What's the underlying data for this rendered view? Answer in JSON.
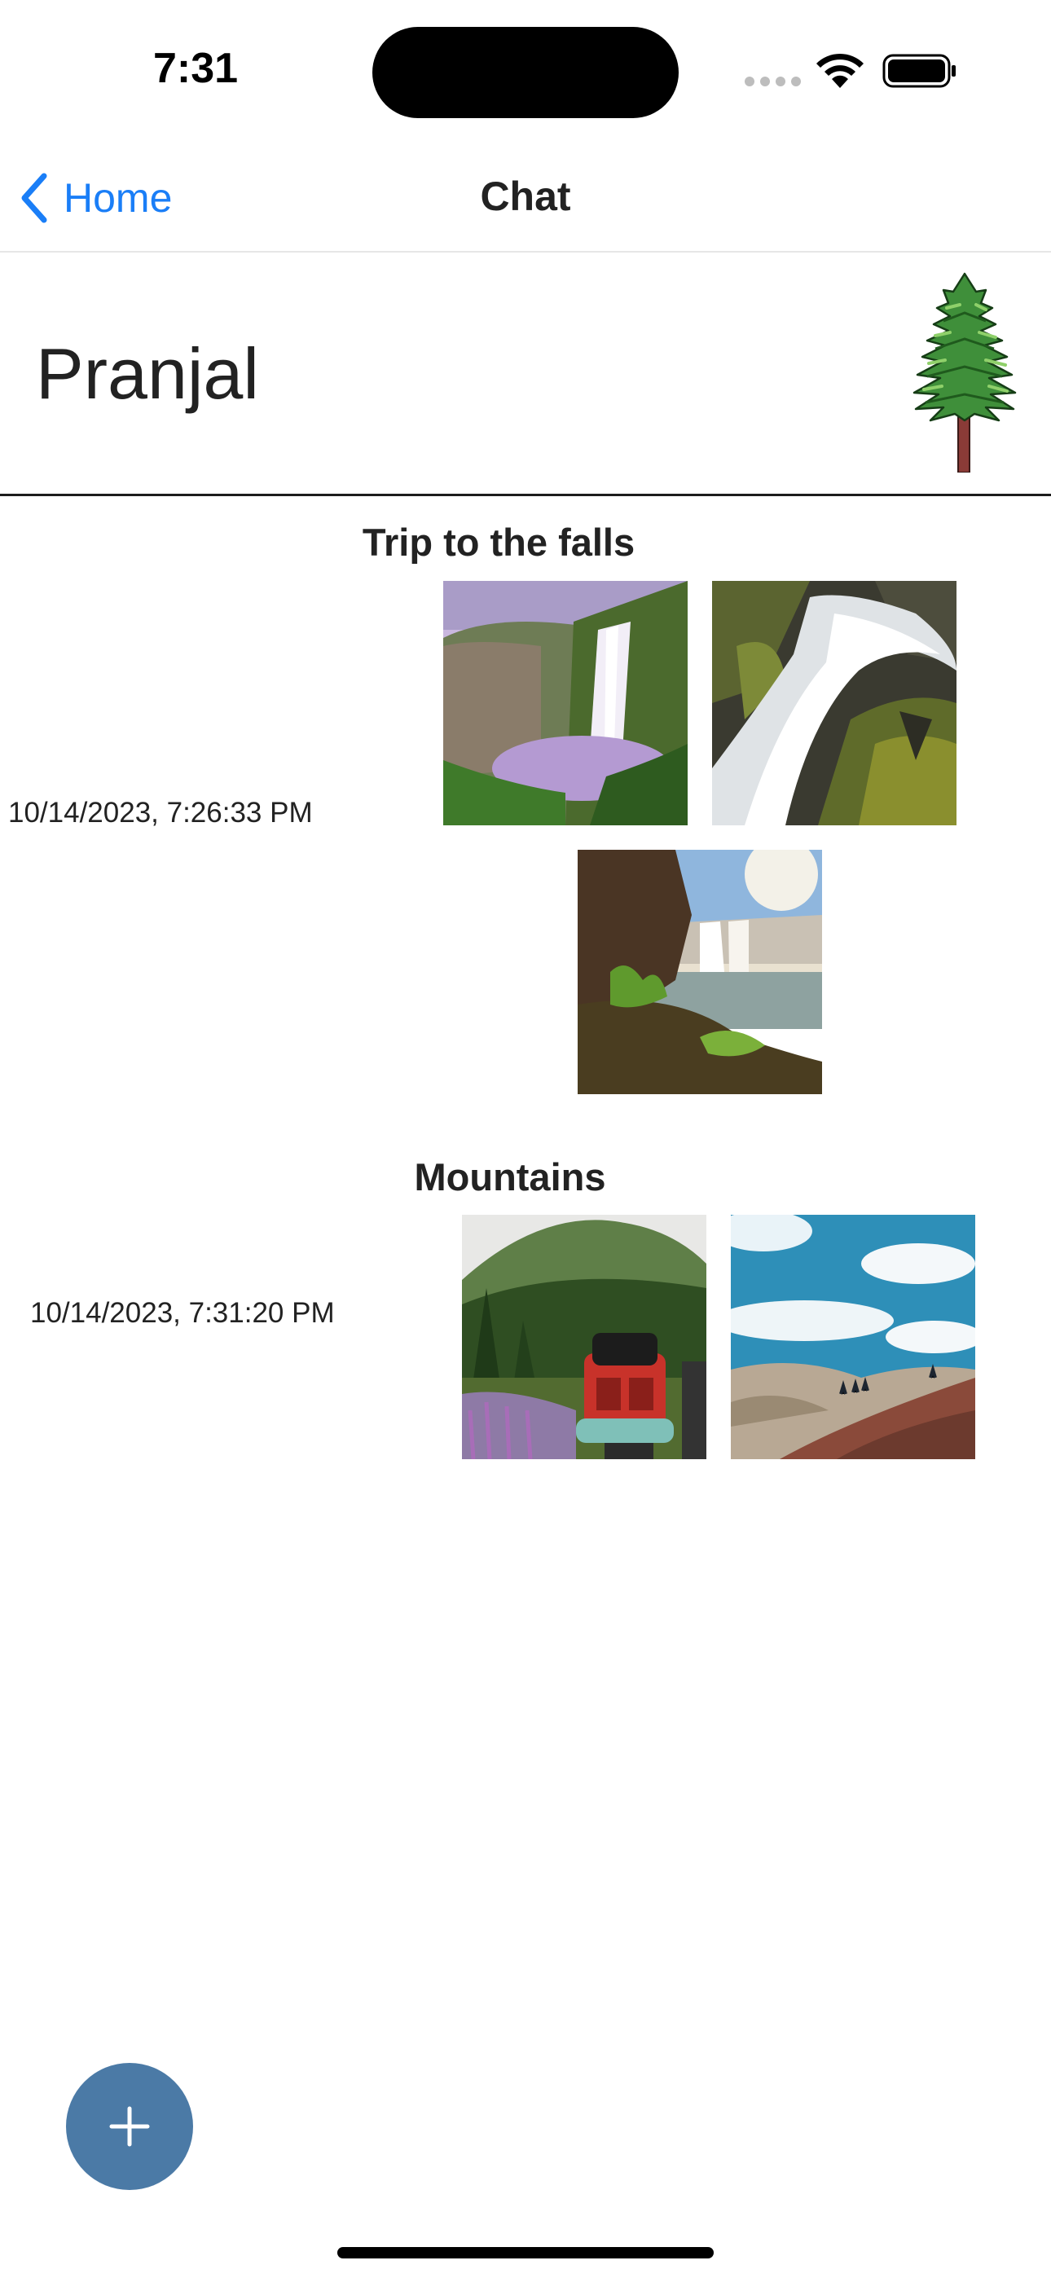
{
  "status_bar": {
    "time": "7:31"
  },
  "nav": {
    "back_label": "Home",
    "title": "Chat"
  },
  "header": {
    "name": "Pranjal",
    "avatar_icon": "pine-tree-icon"
  },
  "posts": [
    {
      "title": "Trip to the falls",
      "timestamp": "10/14/2023, 7:26:33 PM",
      "photos": [
        "waterfall-photo",
        "waterfall-closeup-photo",
        "waterfall-sunlit-photo"
      ]
    },
    {
      "title": "Mountains",
      "timestamp": "10/14/2023, 7:31:20 PM",
      "photos": [
        "hiker-backpack-photo",
        "mountain-sky-photo"
      ]
    }
  ],
  "fab": {
    "icon": "plus-icon"
  },
  "colors": {
    "accent": "#1a7ef7",
    "fab": "#4b7aa6"
  }
}
